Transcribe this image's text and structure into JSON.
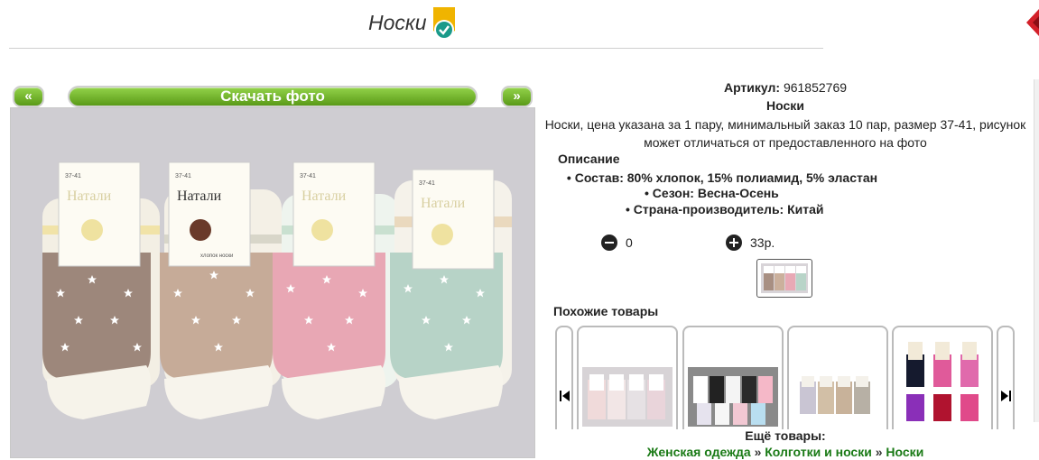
{
  "header": {
    "title": "Носки"
  },
  "gallery": {
    "prev_label": "«",
    "download_label": "Скачать фото",
    "next_label": "»",
    "photo": {
      "brand": "Натали",
      "size": "37-41",
      "material_tag": "хлопок носки"
    }
  },
  "product": {
    "article_label": "Артикул:",
    "article_value": "961852769",
    "name": "Носки",
    "description": "Носки, цена указана за 1 пару, минимальный заказ 10 пар, размер 37-41, рисунок может отличаться от предоставленного на фото",
    "desc_heading": "Описание",
    "specs": [
      "Состав: 80% хлопок, 15% полиамид, 5% эластан",
      "Сезон: Весна-Осень",
      "Страна-производитель: Китай"
    ],
    "quantity": "0",
    "price": "33р."
  },
  "similar": {
    "heading": "Похожие товары",
    "prev_icon": "skip-previous-icon",
    "next_icon": "skip-next-icon"
  },
  "more": {
    "heading": "Ещё товары:",
    "crumbs": [
      "Женская одежда",
      "Колготки и носки",
      "Носки"
    ],
    "separator": "»"
  },
  "colors": {
    "accent_green": "#6cb82a",
    "link_green": "#1a7a16",
    "badge_teal": "#1a9a8a",
    "badge_gold": "#f0b400"
  }
}
